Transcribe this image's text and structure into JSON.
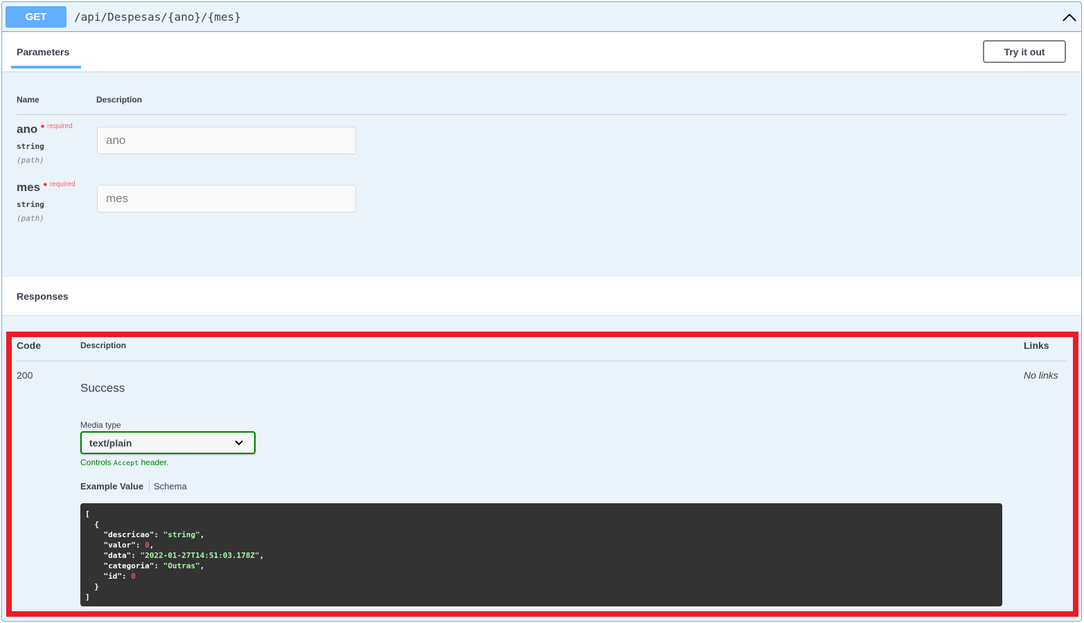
{
  "endpoint": {
    "method": "GET",
    "path": "/api/Despesas/{ano}/{mes}"
  },
  "tabs": {
    "parameters": "Parameters",
    "try_it_out": "Try it out"
  },
  "parameters": {
    "headers": {
      "name": "Name",
      "description": "Description"
    },
    "items": [
      {
        "name": "ano",
        "asterisk": "*",
        "required": "required",
        "type": "string",
        "in": "(path)",
        "placeholder": "ano"
      },
      {
        "name": "mes",
        "asterisk": "*",
        "required": "required",
        "type": "string",
        "in": "(path)",
        "placeholder": "mes"
      }
    ]
  },
  "responses": {
    "title": "Responses",
    "headers": {
      "code": "Code",
      "description": "Description",
      "links": "Links"
    },
    "rows": [
      {
        "code": "200",
        "description": "Success",
        "links": "No links"
      }
    ],
    "media_type_label": "Media type",
    "media_type": "text/plain",
    "controls": {
      "pre": "Controls ",
      "code": "Accept",
      "post": " header."
    },
    "example_tab": "Example Value",
    "schema_tab": "Schema",
    "example": {
      "open": "[",
      "obj_open": "  {",
      "obj_close": "  }",
      "close": "]",
      "fields": [
        {
          "key": "\"descricao\"",
          "value": "\"string\"",
          "kind": "s",
          "comma": ","
        },
        {
          "key": "\"valor\"",
          "value": "0",
          "kind": "n",
          "comma": ","
        },
        {
          "key": "\"data\"",
          "value": "\"2022-01-27T14:51:03.178Z\"",
          "kind": "s",
          "comma": ","
        },
        {
          "key": "\"categoria\"",
          "value": "\"Outras\"",
          "kind": "s",
          "comma": ","
        },
        {
          "key": "\"id\"",
          "value": "0",
          "kind": "n",
          "comma": ""
        }
      ]
    }
  },
  "colors": {
    "get": "#61affe",
    "highlight": "#ed1c24",
    "media_border": "#008000"
  }
}
